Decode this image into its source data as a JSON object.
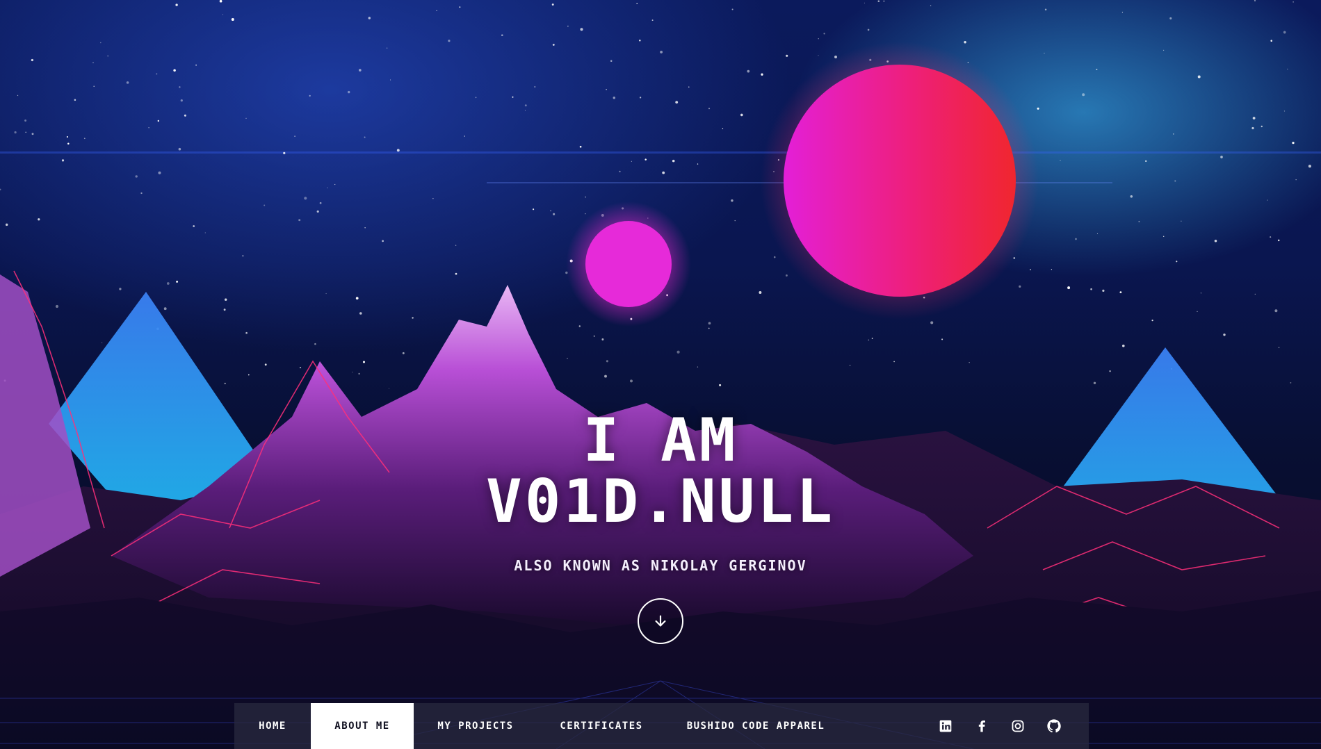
{
  "hero": {
    "title_line1": "I AM",
    "title_line2": "V01D.NULL",
    "subtitle": "ALSO KNOWN AS NIKOLAY GERGINOV",
    "scroll_icon": "arrow-down-icon"
  },
  "nav": {
    "items": [
      {
        "label": "HOME",
        "active": false
      },
      {
        "label": "ABOUT ME",
        "active": true
      },
      {
        "label": "MY PROJECTS",
        "active": false
      },
      {
        "label": "CERTIFICATES",
        "active": false
      },
      {
        "label": "BUSHIDO CODE APPAREL",
        "active": false
      }
    ],
    "social": [
      "linkedin-icon",
      "facebook-icon",
      "instagram-icon",
      "github-icon"
    ]
  },
  "colors": {
    "sky_top": "#0b1a5c",
    "sky_mid": "#081238",
    "planet_large_left": "#e31fd8",
    "planet_large_right": "#f0262e",
    "planet_small": "#e62ad9",
    "mountain_glow": "#c94bd8",
    "wireframe": "#ff2f7a",
    "pyramid": "#2aa6f0",
    "nav_bg": "#28283e",
    "nav_active_bg": "#ffffff"
  }
}
